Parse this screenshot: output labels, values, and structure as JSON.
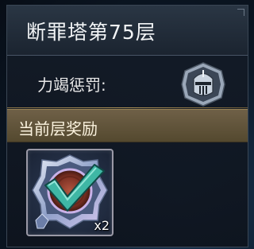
{
  "panel": {
    "title": "断罪塔第75层",
    "penalty_label": "力竭惩罚:",
    "penalty_icon": "knight-helmet-icon"
  },
  "reward_section": {
    "title": "当前层奖励",
    "items": [
      {
        "icon": "checkmark-emblem-icon",
        "count": "x2"
      }
    ]
  },
  "colors": {
    "section_bar": "#6f6047",
    "check_green": "#3fb7a5",
    "emblem_core": "#8a3a2a"
  }
}
